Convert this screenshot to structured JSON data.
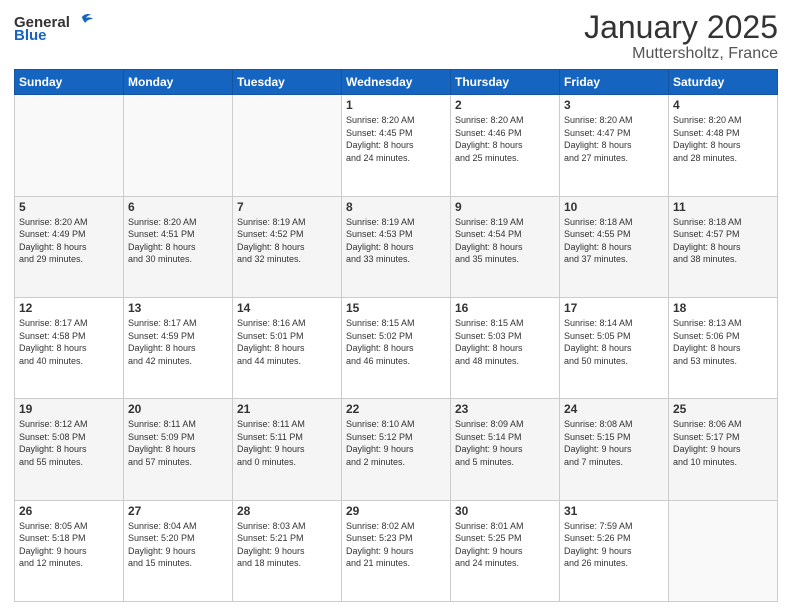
{
  "header": {
    "logo_general": "General",
    "logo_blue": "Blue",
    "title": "January 2025",
    "subtitle": "Muttersholtz, France"
  },
  "weekdays": [
    "Sunday",
    "Monday",
    "Tuesday",
    "Wednesday",
    "Thursday",
    "Friday",
    "Saturday"
  ],
  "weeks": [
    [
      {
        "day": "",
        "info": ""
      },
      {
        "day": "",
        "info": ""
      },
      {
        "day": "",
        "info": ""
      },
      {
        "day": "1",
        "info": "Sunrise: 8:20 AM\nSunset: 4:45 PM\nDaylight: 8 hours\nand 24 minutes."
      },
      {
        "day": "2",
        "info": "Sunrise: 8:20 AM\nSunset: 4:46 PM\nDaylight: 8 hours\nand 25 minutes."
      },
      {
        "day": "3",
        "info": "Sunrise: 8:20 AM\nSunset: 4:47 PM\nDaylight: 8 hours\nand 27 minutes."
      },
      {
        "day": "4",
        "info": "Sunrise: 8:20 AM\nSunset: 4:48 PM\nDaylight: 8 hours\nand 28 minutes."
      }
    ],
    [
      {
        "day": "5",
        "info": "Sunrise: 8:20 AM\nSunset: 4:49 PM\nDaylight: 8 hours\nand 29 minutes."
      },
      {
        "day": "6",
        "info": "Sunrise: 8:20 AM\nSunset: 4:51 PM\nDaylight: 8 hours\nand 30 minutes."
      },
      {
        "day": "7",
        "info": "Sunrise: 8:19 AM\nSunset: 4:52 PM\nDaylight: 8 hours\nand 32 minutes."
      },
      {
        "day": "8",
        "info": "Sunrise: 8:19 AM\nSunset: 4:53 PM\nDaylight: 8 hours\nand 33 minutes."
      },
      {
        "day": "9",
        "info": "Sunrise: 8:19 AM\nSunset: 4:54 PM\nDaylight: 8 hours\nand 35 minutes."
      },
      {
        "day": "10",
        "info": "Sunrise: 8:18 AM\nSunset: 4:55 PM\nDaylight: 8 hours\nand 37 minutes."
      },
      {
        "day": "11",
        "info": "Sunrise: 8:18 AM\nSunset: 4:57 PM\nDaylight: 8 hours\nand 38 minutes."
      }
    ],
    [
      {
        "day": "12",
        "info": "Sunrise: 8:17 AM\nSunset: 4:58 PM\nDaylight: 8 hours\nand 40 minutes."
      },
      {
        "day": "13",
        "info": "Sunrise: 8:17 AM\nSunset: 4:59 PM\nDaylight: 8 hours\nand 42 minutes."
      },
      {
        "day": "14",
        "info": "Sunrise: 8:16 AM\nSunset: 5:01 PM\nDaylight: 8 hours\nand 44 minutes."
      },
      {
        "day": "15",
        "info": "Sunrise: 8:15 AM\nSunset: 5:02 PM\nDaylight: 8 hours\nand 46 minutes."
      },
      {
        "day": "16",
        "info": "Sunrise: 8:15 AM\nSunset: 5:03 PM\nDaylight: 8 hours\nand 48 minutes."
      },
      {
        "day": "17",
        "info": "Sunrise: 8:14 AM\nSunset: 5:05 PM\nDaylight: 8 hours\nand 50 minutes."
      },
      {
        "day": "18",
        "info": "Sunrise: 8:13 AM\nSunset: 5:06 PM\nDaylight: 8 hours\nand 53 minutes."
      }
    ],
    [
      {
        "day": "19",
        "info": "Sunrise: 8:12 AM\nSunset: 5:08 PM\nDaylight: 8 hours\nand 55 minutes."
      },
      {
        "day": "20",
        "info": "Sunrise: 8:11 AM\nSunset: 5:09 PM\nDaylight: 8 hours\nand 57 minutes."
      },
      {
        "day": "21",
        "info": "Sunrise: 8:11 AM\nSunset: 5:11 PM\nDaylight: 9 hours\nand 0 minutes."
      },
      {
        "day": "22",
        "info": "Sunrise: 8:10 AM\nSunset: 5:12 PM\nDaylight: 9 hours\nand 2 minutes."
      },
      {
        "day": "23",
        "info": "Sunrise: 8:09 AM\nSunset: 5:14 PM\nDaylight: 9 hours\nand 5 minutes."
      },
      {
        "day": "24",
        "info": "Sunrise: 8:08 AM\nSunset: 5:15 PM\nDaylight: 9 hours\nand 7 minutes."
      },
      {
        "day": "25",
        "info": "Sunrise: 8:06 AM\nSunset: 5:17 PM\nDaylight: 9 hours\nand 10 minutes."
      }
    ],
    [
      {
        "day": "26",
        "info": "Sunrise: 8:05 AM\nSunset: 5:18 PM\nDaylight: 9 hours\nand 12 minutes."
      },
      {
        "day": "27",
        "info": "Sunrise: 8:04 AM\nSunset: 5:20 PM\nDaylight: 9 hours\nand 15 minutes."
      },
      {
        "day": "28",
        "info": "Sunrise: 8:03 AM\nSunset: 5:21 PM\nDaylight: 9 hours\nand 18 minutes."
      },
      {
        "day": "29",
        "info": "Sunrise: 8:02 AM\nSunset: 5:23 PM\nDaylight: 9 hours\nand 21 minutes."
      },
      {
        "day": "30",
        "info": "Sunrise: 8:01 AM\nSunset: 5:25 PM\nDaylight: 9 hours\nand 24 minutes."
      },
      {
        "day": "31",
        "info": "Sunrise: 7:59 AM\nSunset: 5:26 PM\nDaylight: 9 hours\nand 26 minutes."
      },
      {
        "day": "",
        "info": ""
      }
    ]
  ]
}
